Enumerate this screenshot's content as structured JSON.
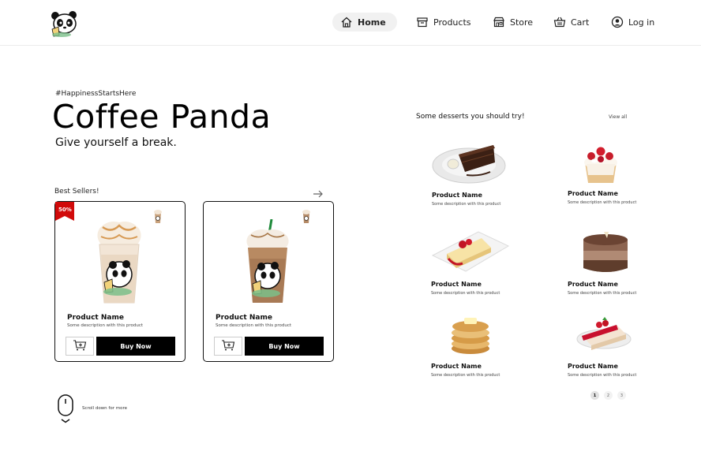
{
  "header": {
    "logo_icon": "panda-logo",
    "nav": [
      {
        "label": "Home",
        "icon": "home-icon",
        "active": true
      },
      {
        "label": "Products",
        "icon": "box-icon",
        "active": false
      },
      {
        "label": "Store",
        "icon": "store-icon",
        "active": false
      },
      {
        "label": "Cart",
        "icon": "basket-icon",
        "active": false
      },
      {
        "label": "Log in",
        "icon": "user-icon",
        "active": false
      }
    ]
  },
  "hero": {
    "hashtag": "#HappinessStartsHere",
    "title": "Coffee Panda",
    "subtitle": "Give yourself a break."
  },
  "best_sellers": {
    "label": "Best Sellers!",
    "products": [
      {
        "badge": "50%",
        "name": "Product Name",
        "description": "Some description with this product",
        "buy_label": "Buy Now"
      },
      {
        "badge": "",
        "name": "Product Name",
        "description": "Some description with this product",
        "buy_label": "Buy Now"
      }
    ]
  },
  "scroll_hint": "Scroll down for more",
  "desserts": {
    "title": "Some desserts you should try!",
    "view_all": "View all",
    "items": [
      {
        "name": "Product Name",
        "description": "Some description with this product",
        "image": "chocolate-cake"
      },
      {
        "name": "Product Name",
        "description": "Some description with this product",
        "image": "strawberry-cream-cake"
      },
      {
        "name": "Product Name",
        "description": "Some description with this product",
        "image": "cheesecake"
      },
      {
        "name": "Product Name",
        "description": "Some description with this product",
        "image": "chocolate-mousse"
      },
      {
        "name": "Product Name",
        "description": "Some description with this product",
        "image": "pancakes"
      },
      {
        "name": "Product Name",
        "description": "Some description with this product",
        "image": "strawberry-cake"
      }
    ],
    "pages": [
      "1",
      "2",
      "3"
    ],
    "current_page": "1"
  },
  "colors": {
    "badge": "#d10a0a",
    "button": "#000000",
    "nav_active_bg": "#f1f1f1"
  }
}
